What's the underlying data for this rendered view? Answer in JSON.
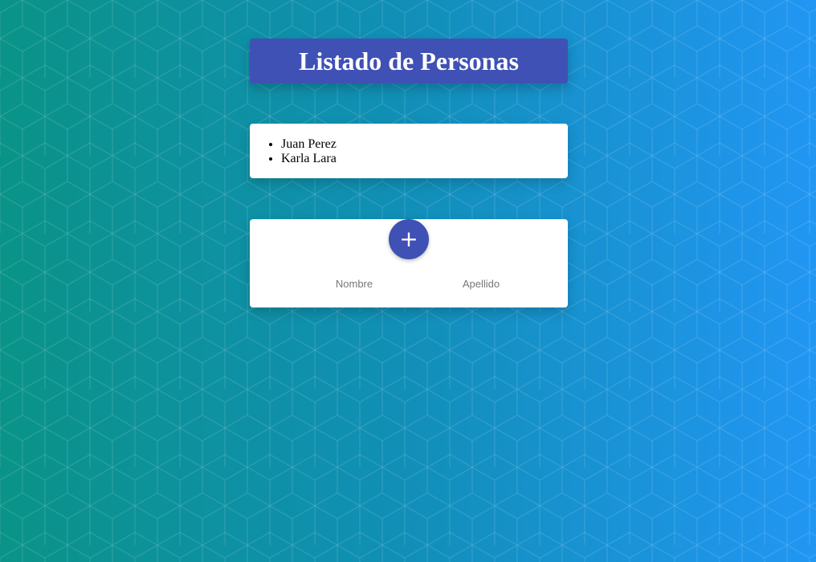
{
  "header": {
    "title": "Listado de Personas"
  },
  "people": [
    "Juan Perez",
    "Karla Lara"
  ],
  "form": {
    "add_label": "+",
    "nombre_placeholder": "Nombre",
    "apellido_placeholder": "Apellido"
  },
  "colors": {
    "primary": "#3f51b5",
    "gradient_start": "#0a9387",
    "gradient_end": "#2196f3",
    "card": "#ffffff"
  },
  "icons": {
    "add": "plus-icon"
  }
}
